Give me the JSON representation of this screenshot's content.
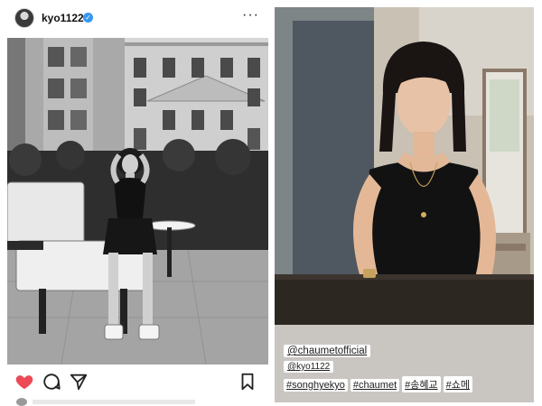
{
  "post": {
    "username": "kyo1122",
    "verified_icon": "verified-badge-icon",
    "more_icon": "more-options-icon",
    "more_label": "···",
    "photo_alt": "Black-and-white photo of a woman seated on a terrace with a lounge chair, hedge and Parisian building",
    "actions": {
      "like_icon": "heart-icon",
      "like_color": "#ed4956",
      "comment_icon": "comment-icon",
      "share_icon": "send-icon",
      "save_icon": "bookmark-icon"
    }
  },
  "story": {
    "photo_alt": "Color photo of a woman in a black sleeveless top with a gold necklace, seated at a table",
    "mentions": [
      "@chaumetofficial",
      "@kyo1122"
    ],
    "hashtags": [
      "#songhyekyo",
      "#chaumet",
      "#송혜교",
      "#쇼메"
    ]
  },
  "colors": {
    "verified_blue": "#3897f0",
    "like_red": "#ed4956"
  }
}
